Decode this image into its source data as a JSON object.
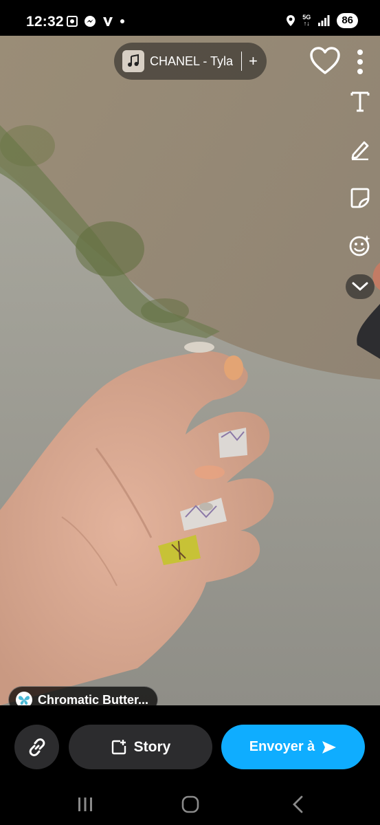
{
  "status_bar": {
    "time": "12:32",
    "left_icons": [
      "screenshot-icon",
      "messenger-icon",
      "v-app-icon",
      "dot-icon"
    ],
    "network_label": "5G",
    "battery": "86"
  },
  "top_controls": {
    "music_title": "CHANEL - Tyla",
    "add_label": "+"
  },
  "side_tools": [
    "text-tool-icon",
    "pencil-icon",
    "sticker-icon",
    "emoji-lens-icon",
    "chevron-down-icon"
  ],
  "lens": {
    "label": "Chromatic Butter..."
  },
  "actions": {
    "story_label": "Story",
    "send_label": "Envoyer à"
  },
  "colors": {
    "send_button": "#0fadff",
    "dark_button": "#2c2c2e"
  }
}
